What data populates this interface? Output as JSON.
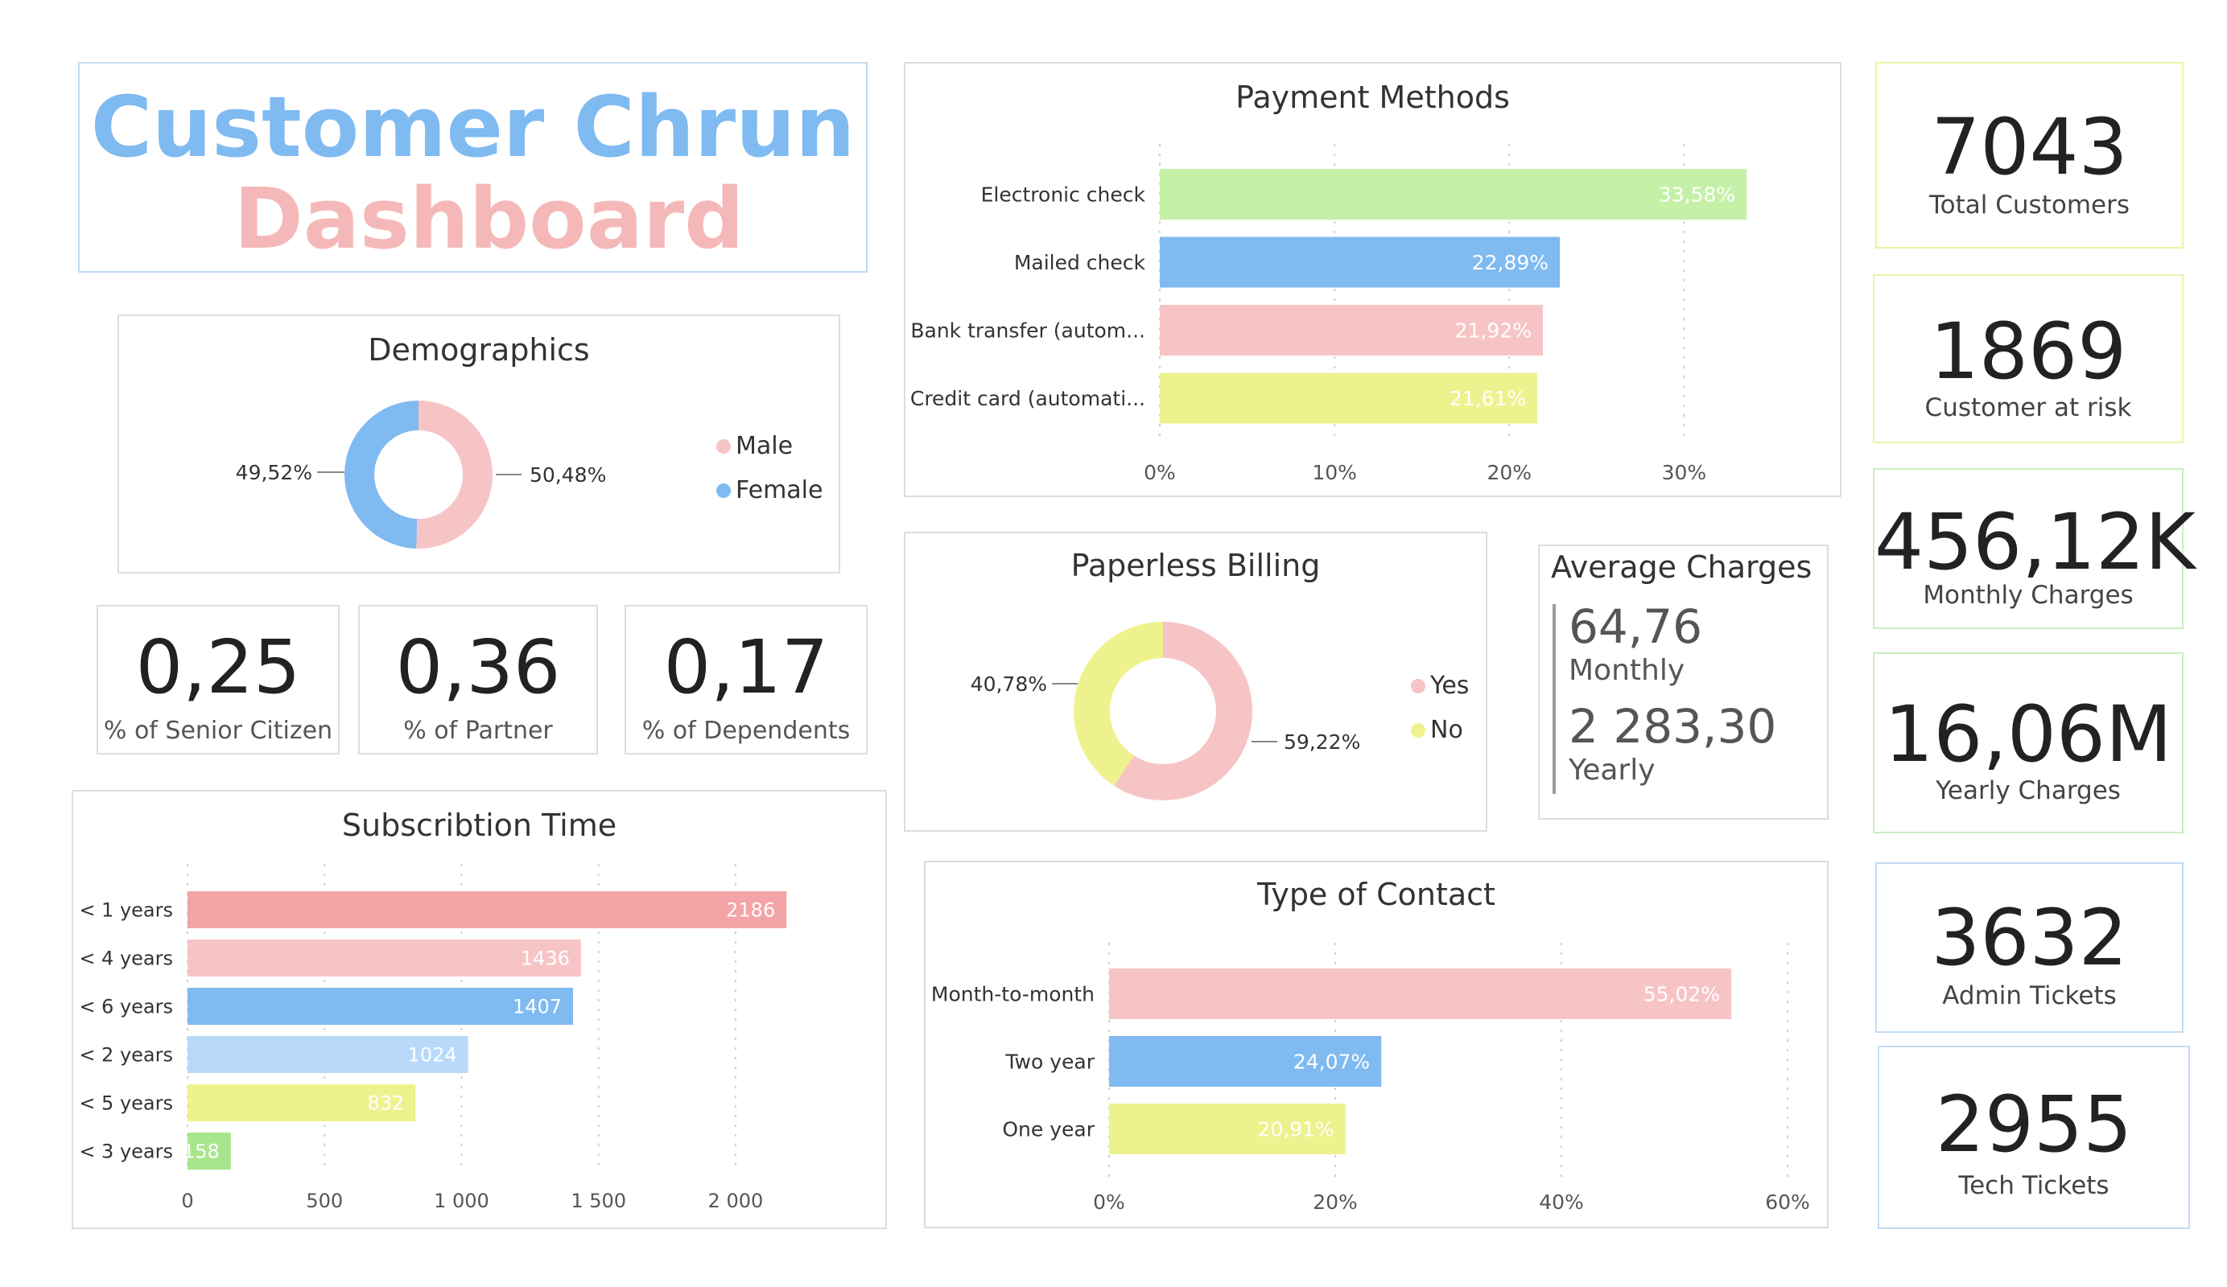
{
  "title": {
    "line1": "Customer Chrun",
    "line2": "Dashboard"
  },
  "colors": {
    "pink": "#f7c4c6",
    "blue": "#7fbaf0",
    "green": "#c5f0a8",
    "yellow": "#eef28e",
    "red": "#f3a4a7",
    "light_blue": "#b9d9fb",
    "light_green": "#a8e68c"
  },
  "demographics": {
    "title": "Demographics",
    "legend": [
      {
        "label": "Male",
        "color": "#f7c4c6"
      },
      {
        "label": "Female",
        "color": "#7fbaf0"
      }
    ],
    "slices": [
      {
        "label": "50,48%",
        "value": 50.48
      },
      {
        "label": "49,52%",
        "value": 49.52
      }
    ]
  },
  "metrics": [
    {
      "value": "0,25",
      "label": "% of Senior Citizen"
    },
    {
      "value": "0,36",
      "label": "% of Partner"
    },
    {
      "value": "0,17",
      "label": "% of Dependents"
    }
  ],
  "subscription": {
    "title": "Subscribtion Time",
    "ticks": [
      "0",
      "500",
      "1 000",
      "1 500",
      "2 000"
    ]
  },
  "payment": {
    "title": "Payment Methods",
    "ticks": [
      "0%",
      "10%",
      "20%",
      "30%"
    ]
  },
  "paperless": {
    "title": "Paperless Billing",
    "legend": [
      {
        "label": "Yes",
        "color": "#f7c4c6"
      },
      {
        "label": "No",
        "color": "#eef28e"
      }
    ],
    "slices": [
      {
        "label": "59,22%",
        "value": 59.22
      },
      {
        "label": "40,78%",
        "value": 40.78
      }
    ]
  },
  "average_charges": {
    "title": "Average Charges",
    "monthly_value": "64,76",
    "monthly_label": "Monthly",
    "yearly_value": "2 283,30",
    "yearly_label": "Yearly"
  },
  "contract": {
    "title": "Type of Contact",
    "ticks": [
      "0%",
      "20%",
      "40%",
      "60%"
    ]
  },
  "kpis": {
    "total": {
      "value": "7043",
      "label": "Total Customers"
    },
    "risk": {
      "value": "1869",
      "label": "Customer at risk"
    },
    "monthly": {
      "value": "456,12K",
      "label": "Monthly Charges"
    },
    "yearly": {
      "value": "16,06M",
      "label": "Yearly Charges"
    },
    "admin": {
      "value": "3632",
      "label": "Admin Tickets"
    },
    "tech": {
      "value": "2955",
      "label": "Tech Tickets"
    }
  },
  "chart_data": [
    {
      "type": "pie",
      "title": "Demographics",
      "categories": [
        "Male",
        "Female"
      ],
      "values": [
        50.48,
        49.52
      ],
      "legend": "right"
    },
    {
      "type": "bar",
      "title": "Subscribtion Time",
      "categories": [
        "< 1 years",
        "< 4 years",
        "< 6 years",
        "< 2 years",
        "< 5 years",
        "< 3 years"
      ],
      "values": [
        2186,
        1436,
        1407,
        1024,
        832,
        158
      ],
      "value_labels": [
        "2186",
        "1436",
        "1407",
        "1024",
        "832",
        "158"
      ],
      "colors": [
        "#f3a4a7",
        "#f7c4c6",
        "#7fbaf0",
        "#b9d9fb",
        "#eef28e",
        "#a8e68c"
      ],
      "xlim": [
        0,
        2200
      ],
      "grid": true,
      "orientation": "horizontal"
    },
    {
      "type": "bar",
      "title": "Payment Methods",
      "categories": [
        "Electronic check",
        "Mailed check",
        "Bank transfer (autom...",
        "Credit card (automati..."
      ],
      "values": [
        33.58,
        22.89,
        21.92,
        21.61
      ],
      "value_labels": [
        "33,58%",
        "22,89%",
        "21,92%",
        "21,61%"
      ],
      "colors": [
        "#c5f0a8",
        "#7fbaf0",
        "#f7c4c6",
        "#eef28e"
      ],
      "xlim": [
        0,
        35
      ],
      "grid": true,
      "orientation": "horizontal"
    },
    {
      "type": "pie",
      "title": "Paperless Billing",
      "categories": [
        "Yes",
        "No"
      ],
      "values": [
        59.22,
        40.78
      ],
      "legend": "right"
    },
    {
      "type": "bar",
      "title": "Type of Contact",
      "categories": [
        "Month-to-month",
        "Two year",
        "One year"
      ],
      "values": [
        55.02,
        24.07,
        20.91
      ],
      "value_labels": [
        "55,02%",
        "24,07%",
        "20,91%"
      ],
      "colors": [
        "#f7c4c6",
        "#7fbaf0",
        "#eef28e"
      ],
      "xlim": [
        0,
        60
      ],
      "grid": true,
      "orientation": "horizontal"
    }
  ]
}
